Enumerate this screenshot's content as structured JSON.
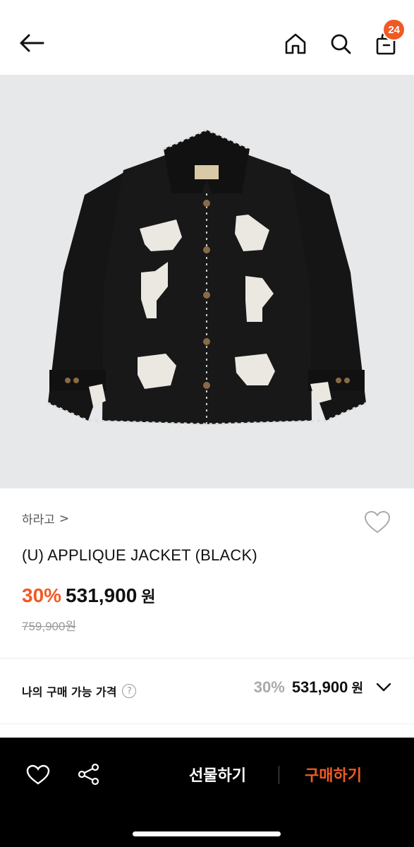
{
  "header": {
    "back_icon": "arrow-left-icon",
    "home_icon": "home-icon",
    "search_icon": "search-icon",
    "bag_icon": "shopping-bag-icon",
    "cart_count": "24",
    "badge_color": "#f05a24"
  },
  "product": {
    "image_alt": "black wool jacket with white animal appliques",
    "brand": "하라고",
    "brand_chevron": ">",
    "title": "(U) APPLIQUE JACKET (BLACK)",
    "discount": "30%",
    "price": "531,900",
    "price_unit": "원",
    "original_price": "759,900원"
  },
  "my_price": {
    "label": "나의 구매 가능 가격",
    "help": "?",
    "discount": "30%",
    "price": "531,900",
    "unit": "원"
  },
  "bottom_bar": {
    "gift_label": "선물하기",
    "buy_label": "구매하기",
    "accent": "#f05a24"
  }
}
